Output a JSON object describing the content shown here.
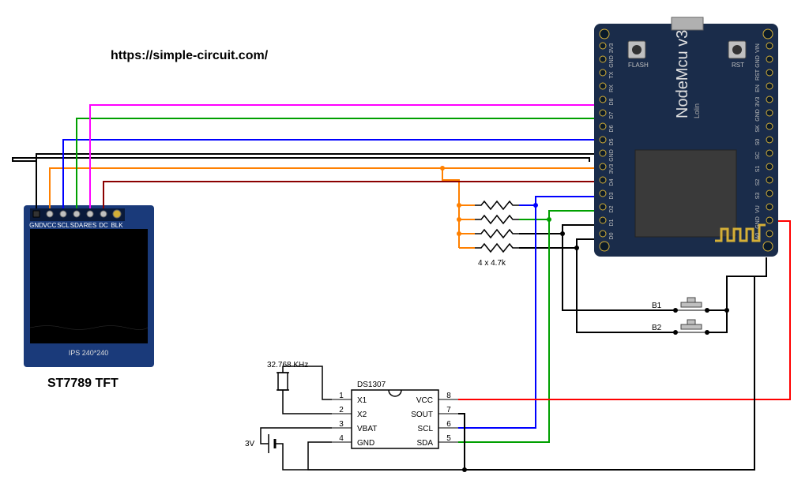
{
  "url": "https://simple-circuit.com/",
  "tft": {
    "title": "ST7789 TFT",
    "res_label": "IPS 240*240",
    "pins": [
      "GND",
      "VCC",
      "SCL",
      "SDA",
      "RES",
      "DC",
      "BLK"
    ]
  },
  "nodemcu": {
    "title": "NodeMcu v3",
    "sub": "Lolin",
    "pins_left": [
      "A0",
      "GND",
      "VU",
      "S3",
      "S2",
      "S1",
      "SC",
      "S0",
      "SK",
      "GND",
      "3V3",
      "EN",
      "RST",
      "GND",
      "VIN"
    ],
    "pins_right": [
      "D0",
      "D1",
      "D2",
      "D3",
      "D4",
      "3V3",
      "GND",
      "D5",
      "D6",
      "D7",
      "D8",
      "RX",
      "TX",
      "GND",
      "3V3"
    ],
    "btn_flash": "FLASH",
    "btn_rst": "RST"
  },
  "ds1307": {
    "label": "DS1307",
    "crystal": "32.768 KHz",
    "battery": "3V",
    "pins_left": [
      "X1",
      "X2",
      "VBAT",
      "GND"
    ],
    "pins_right": [
      "VCC",
      "SOUT",
      "SCL",
      "SDA"
    ],
    "nums_left": [
      "1",
      "2",
      "3",
      "4"
    ],
    "nums_right": [
      "8",
      "7",
      "6",
      "5"
    ]
  },
  "buttons": {
    "b1": "B1",
    "b2": "B2"
  },
  "resistors": "4 x 4.7k",
  "colors": {
    "magenta": "#ff00ff",
    "green": "#00a000",
    "blue": "#0000ff",
    "black": "#000000",
    "orange": "#ff8000",
    "brown": "#8b0000",
    "red": "#ff0000"
  }
}
